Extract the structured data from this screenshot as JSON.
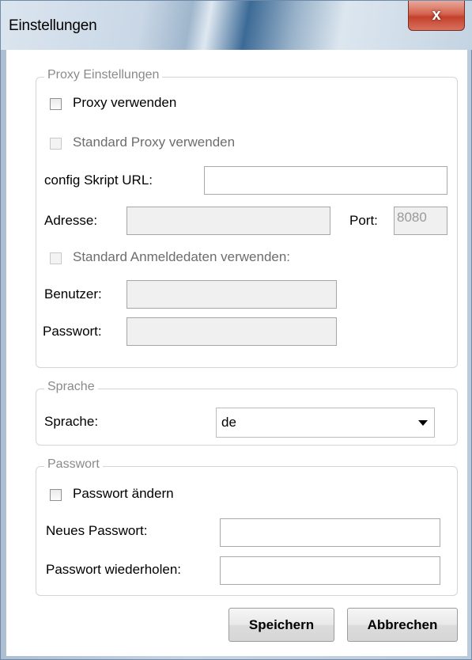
{
  "window": {
    "title": "Einstellungen",
    "close_glyph": "x"
  },
  "proxy": {
    "legend": "Proxy Einstellungen",
    "use_proxy_label": "Proxy verwenden",
    "standard_proxy_label": "Standard Proxy verwenden",
    "config_url_label": "config Skript URL:",
    "config_url_value": "",
    "address_label": "Adresse:",
    "address_value": "",
    "port_label": "Port:",
    "port_value": "8080",
    "standard_credentials_label": "Standard Anmeldedaten verwenden:",
    "user_label": "Benutzer:",
    "user_value": "",
    "password_label": "Passwort:",
    "password_value": ""
  },
  "language": {
    "legend": "Sprache",
    "label": "Sprache:",
    "selected": "de"
  },
  "password": {
    "legend": "Passwort",
    "change_label": "Passwort ändern",
    "new_label": "Neues Passwort:",
    "new_value": "",
    "repeat_label": "Passwort wiederholen:",
    "repeat_value": ""
  },
  "buttons": {
    "save": "Speichern",
    "cancel": "Abbrechen"
  },
  "colors": {
    "close_button": "#c3412b",
    "disabled_field": "#f0f0f0"
  }
}
